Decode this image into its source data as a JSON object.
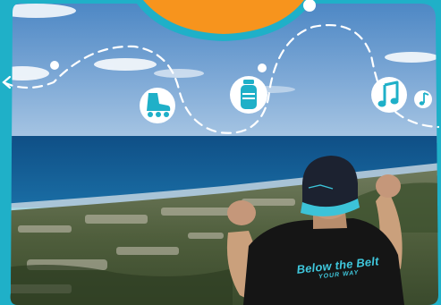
{
  "scene": {
    "frame_color": "#1fb0c8",
    "top_tab_color": "#f7941d",
    "path_color": "#ffffff",
    "icon_fill": "#1fb0c8",
    "icons": [
      "rollerskate-icon",
      "water-bottle-icon",
      "music-note-icon",
      "music-note-small-icon"
    ]
  },
  "shirt": {
    "line1": "Below the Belt",
    "line2": "YOUR WAY"
  }
}
